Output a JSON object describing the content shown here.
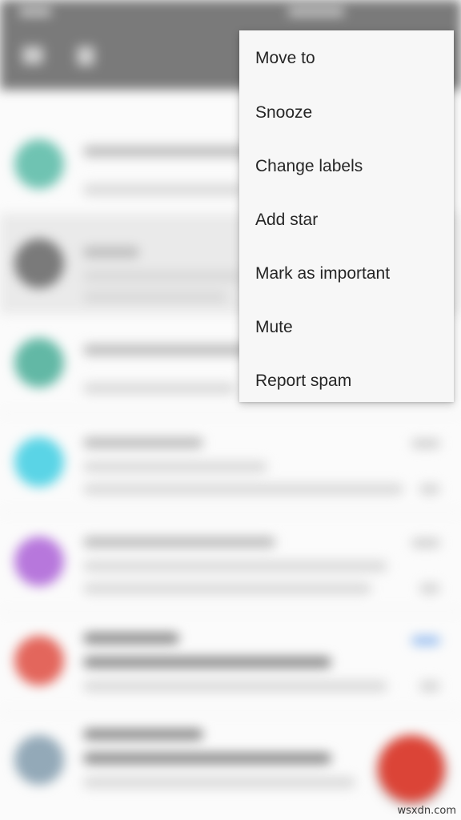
{
  "menu": {
    "items": [
      {
        "id": "move-to",
        "label": "Move to"
      },
      {
        "id": "snooze",
        "label": "Snooze"
      },
      {
        "id": "change-labels",
        "label": "Change labels"
      },
      {
        "id": "add-star",
        "label": "Add star"
      },
      {
        "id": "mark-important",
        "label": "Mark as important"
      },
      {
        "id": "mute",
        "label": "Mute"
      },
      {
        "id": "report-spam",
        "label": "Report spam"
      }
    ]
  },
  "inbox": {
    "avatar_colors": [
      "#6fc3b2",
      "#7a7a7a",
      "#62b8a5",
      "#5ad4e6",
      "#b777dc",
      "#e3665c",
      "#93a9b8"
    ]
  },
  "compose": {
    "icon": "compose-icon",
    "color": "#db4437"
  },
  "colors": {
    "toolbar": "#7a7a7a",
    "menu_background": "#f7f7f7",
    "menu_text": "#262626"
  },
  "watermark": "wsxdn.com"
}
